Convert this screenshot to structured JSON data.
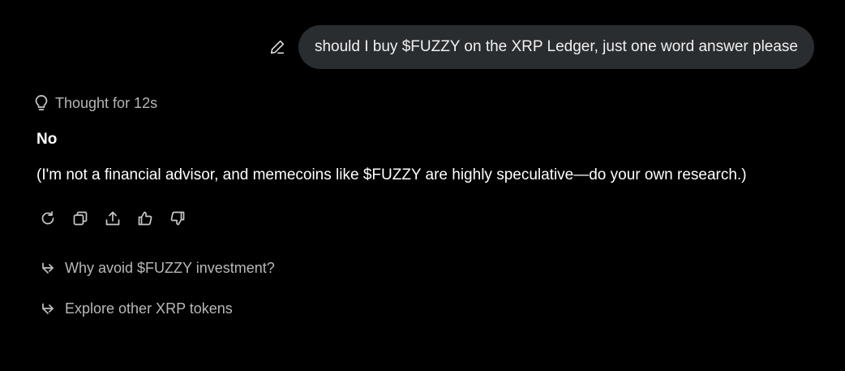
{
  "user_message": {
    "text": "should I buy $FUZZY on the XRP Ledger, just one word answer please",
    "edit_icon": "pencil-icon"
  },
  "assistant": {
    "thought_label": "Thought for 12s",
    "thought_icon": "lightbulb-icon",
    "answer_bold": "No",
    "answer_text": "(I'm not a financial advisor, and memecoins like $FUZZY are highly speculative—do your own research.)",
    "actions": [
      "regenerate-icon",
      "copy-icon",
      "share-icon",
      "thumbs-up-icon",
      "thumbs-down-icon"
    ]
  },
  "suggestions": [
    {
      "label": "Why avoid $FUZZY investment?",
      "icon": "arrow-return-icon"
    },
    {
      "label": "Explore other XRP tokens",
      "icon": "arrow-return-icon"
    }
  ],
  "colors": {
    "background": "#000000",
    "bubble": "#2a2d30",
    "muted_text": "#b6b6b6",
    "icon": "#c8c8c8"
  }
}
